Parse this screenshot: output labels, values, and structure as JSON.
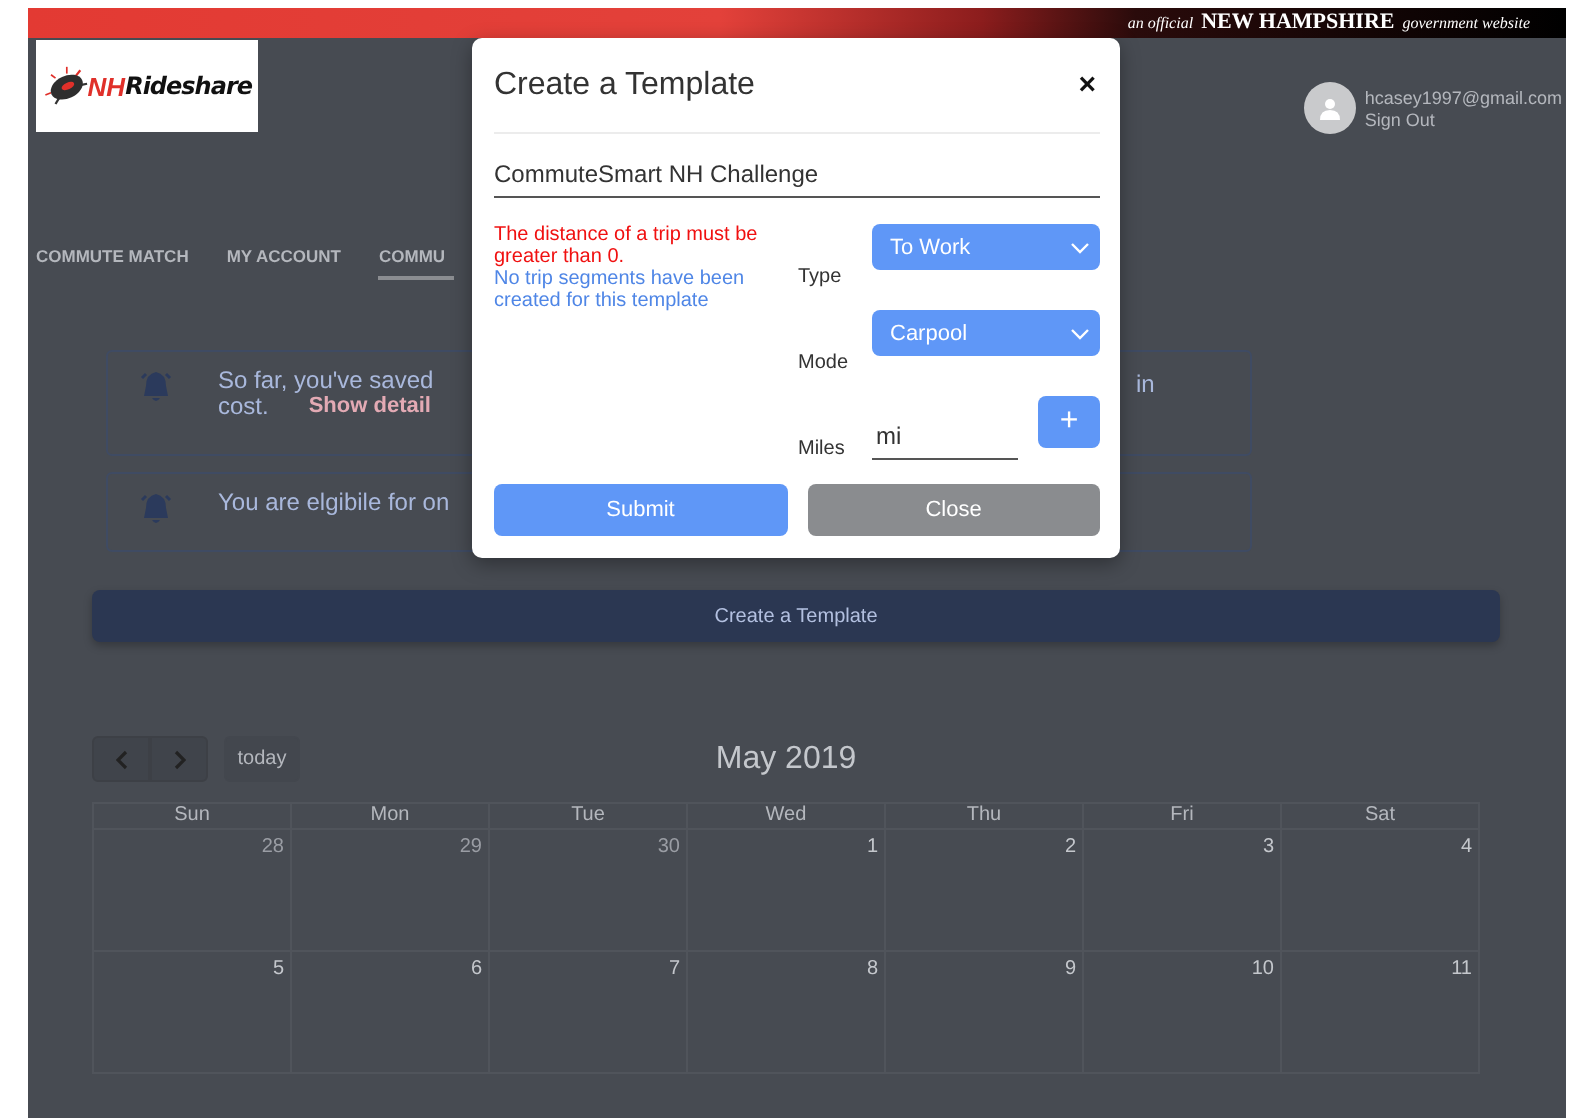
{
  "banner": {
    "prefix": "an official",
    "state": "NEW HAMPSHIRE",
    "suffix": "government website"
  },
  "logo": {
    "accent": "NH",
    "name": "Rideshare"
  },
  "user": {
    "email": "hcasey1997@gmail.com",
    "sign_out": "Sign Out"
  },
  "nav": [
    {
      "label": "COMMUTE MATCH",
      "selected": false
    },
    {
      "label": "MY ACCOUNT",
      "selected": false
    },
    {
      "label": "COMMU",
      "selected": true
    }
  ],
  "alerts": [
    {
      "text": "So far, you've saved",
      "text_right": "in",
      "line2": "cost.",
      "link": "Show detail"
    },
    {
      "text": "You are elgibile for on"
    }
  ],
  "create_button": "Create a Template",
  "calendar": {
    "today": "today",
    "title": "May 2019",
    "weekdays": [
      "Sun",
      "Mon",
      "Tue",
      "Wed",
      "Thu",
      "Fri",
      "Sat"
    ],
    "weeks": [
      [
        {
          "day": "28",
          "other_month": true
        },
        {
          "day": "29",
          "other_month": true
        },
        {
          "day": "30",
          "other_month": true
        },
        {
          "day": "1",
          "other_month": false
        },
        {
          "day": "2",
          "other_month": false
        },
        {
          "day": "3",
          "other_month": false
        },
        {
          "day": "4",
          "other_month": false
        }
      ],
      [
        {
          "day": "5",
          "other_month": false
        },
        {
          "day": "6",
          "other_month": false
        },
        {
          "day": "7",
          "other_month": false
        },
        {
          "day": "8",
          "other_month": false
        },
        {
          "day": "9",
          "other_month": false
        },
        {
          "day": "10",
          "other_month": false
        },
        {
          "day": "11",
          "other_month": false
        }
      ]
    ]
  },
  "modal": {
    "title": "Create a Template",
    "close": "×",
    "name_value": "CommuteSmart NH Challenge",
    "error": "The distance of a trip must be greater than 0.",
    "info": "No trip segments have been created for this template",
    "type": {
      "label": "Type",
      "value": "To Work"
    },
    "mode": {
      "label": "Mode",
      "value": "Carpool"
    },
    "miles": {
      "label": "Miles",
      "placeholder": "mi"
    },
    "add": "+",
    "submit": "Submit",
    "close_button": "Close"
  }
}
